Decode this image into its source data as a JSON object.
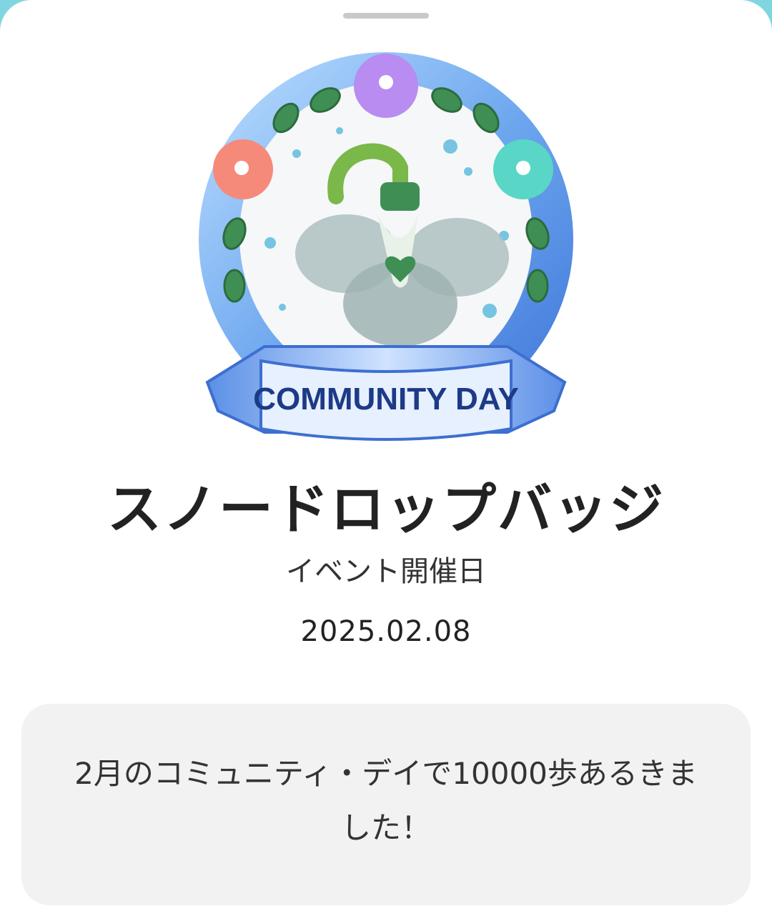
{
  "badge": {
    "name": "スノードロップバッジ",
    "ribbon_text": "COMMUNITY DAY",
    "event_label": "イベント開催日",
    "event_date": "2025.02.08",
    "description": "2月のコミュニティ・デイで10000歩あるきました！",
    "icon": "snowdrop-flower-badge"
  },
  "colors": {
    "background": "#7fd6e0",
    "card": "#f2f2f2",
    "title_text": "#222222"
  }
}
